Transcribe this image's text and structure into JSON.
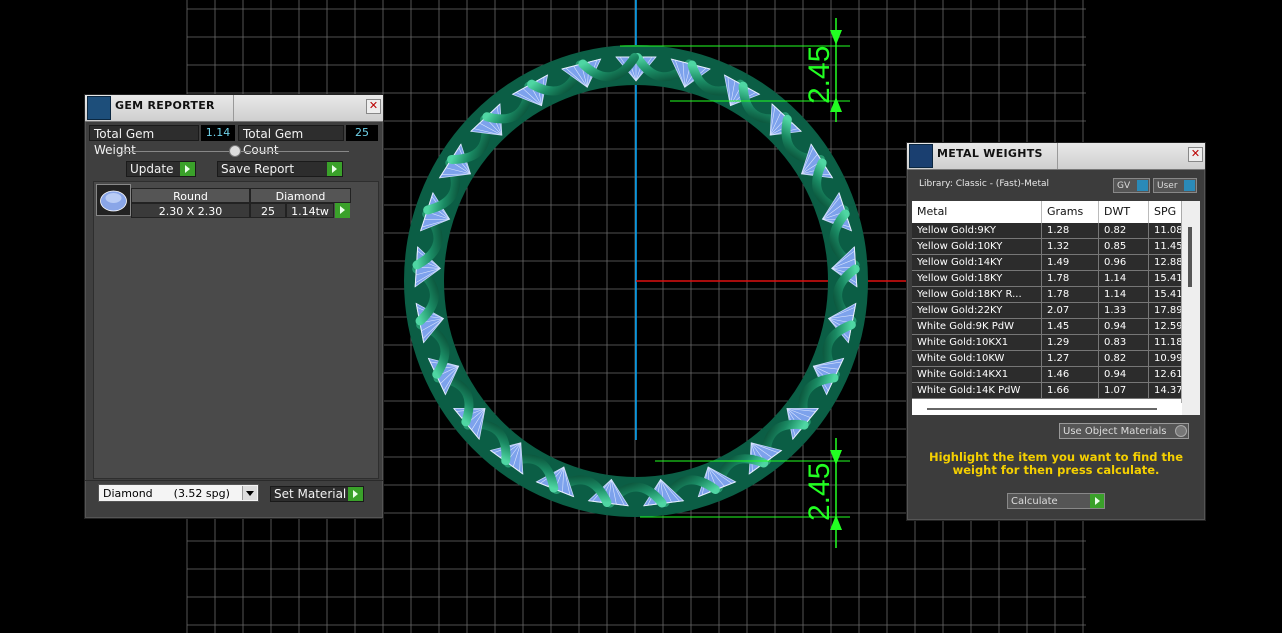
{
  "viewport": {
    "dimension_top": "2.45",
    "dimension_bottom": "2.45"
  },
  "gem_reporter": {
    "title": "GEM REPORTER",
    "total_gem_weight_label": "Total Gem Weight",
    "total_gem_weight_value": "1.14",
    "total_gem_count_label": "Total Gem Count",
    "total_gem_count_value": "25",
    "update_label": "Update",
    "save_report_label": "Save Report",
    "table": {
      "headers": [
        "Round",
        "Diamond"
      ],
      "rows": [
        {
          "size": "2.30 X 2.30",
          "count": "25",
          "weight": "1.14tw"
        }
      ]
    },
    "material_select": "Diamond      (3.52 spg)",
    "set_material_label": "Set Material"
  },
  "metal_weights": {
    "title": "METAL WEIGHTS",
    "library": "Library: Classic - (Fast)-Metal",
    "gv_label": "GV",
    "user_label": "User",
    "columns": [
      "Metal",
      "Grams",
      "DWT",
      "SPG"
    ],
    "rows": [
      [
        "Yellow Gold:9KY",
        "1.28",
        "0.82",
        "11.08"
      ],
      [
        "Yellow Gold:10KY",
        "1.32",
        "0.85",
        "11.45"
      ],
      [
        "Yellow Gold:14KY",
        "1.49",
        "0.96",
        "12.88"
      ],
      [
        "Yellow Gold:18KY",
        "1.78",
        "1.14",
        "15.41"
      ],
      [
        "Yellow Gold:18KY R...",
        "1.78",
        "1.14",
        "15.41"
      ],
      [
        "Yellow Gold:22KY",
        "2.07",
        "1.33",
        "17.89"
      ],
      [
        "White Gold:9K PdW",
        "1.45",
        "0.94",
        "12.59"
      ],
      [
        "White Gold:10KX1",
        "1.29",
        "0.83",
        "11.18"
      ],
      [
        "White Gold:10KW",
        "1.27",
        "0.82",
        "10.99"
      ],
      [
        "White Gold:14KX1",
        "1.46",
        "0.94",
        "12.61"
      ],
      [
        "White Gold:14K PdW",
        "1.66",
        "1.07",
        "14.37"
      ]
    ],
    "use_object_materials_label": "Use Object Materials",
    "instruction": "Highlight the item you want to find the weight for then press calculate.",
    "calculate_label": "Calculate"
  }
}
